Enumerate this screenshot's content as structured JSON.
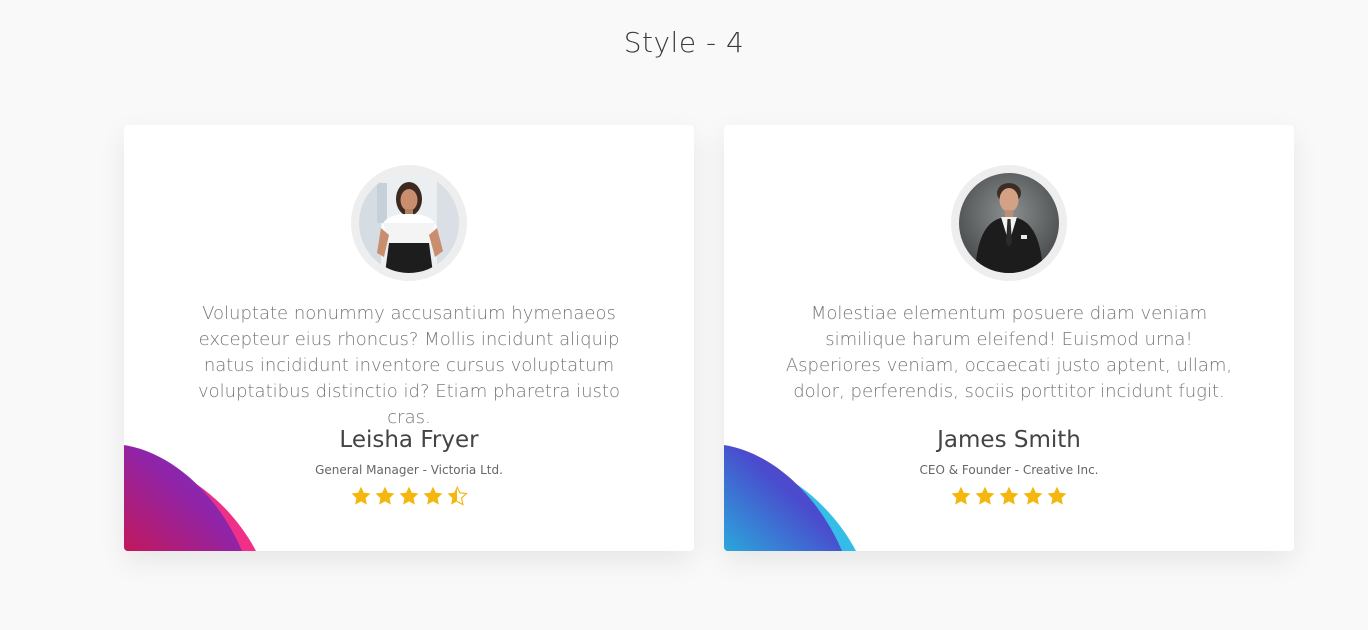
{
  "page_title": "Style - 4",
  "colors": {
    "background": "#f9f9f9",
    "card": "#ffffff",
    "star": "#f5b70f",
    "left_corner_gradient": [
      "#c2185b",
      "#8e24aa",
      "#7b3fc4"
    ],
    "right_corner_gradient": [
      "#2ba7dc",
      "#4a4ccd",
      "#29b6e6"
    ]
  },
  "testimonials": [
    {
      "quote": "Voluptate nonummy accusantium hymenaeos excepteur eius rhoncus? Mollis incidunt aliquip natus incididunt inventore cursus voluptatum voluptatibus distinctio id? Etiam pharetra iusto cras.",
      "name": "Leisha Fryer",
      "role": "General Manager - Victoria Ltd.",
      "rating": 4.5,
      "avatar_icon": "woman-portrait"
    },
    {
      "quote": "Molestiae elementum posuere diam veniam similique harum eleifend! Euismod urna! Asperiores veniam, occaecati justo aptent, ullam, dolor, perferendis, sociis porttitor incidunt fugit.",
      "name": "James Smith",
      "role": "CEO & Founder - Creative Inc.",
      "rating": 5,
      "avatar_icon": "man-portrait"
    }
  ]
}
